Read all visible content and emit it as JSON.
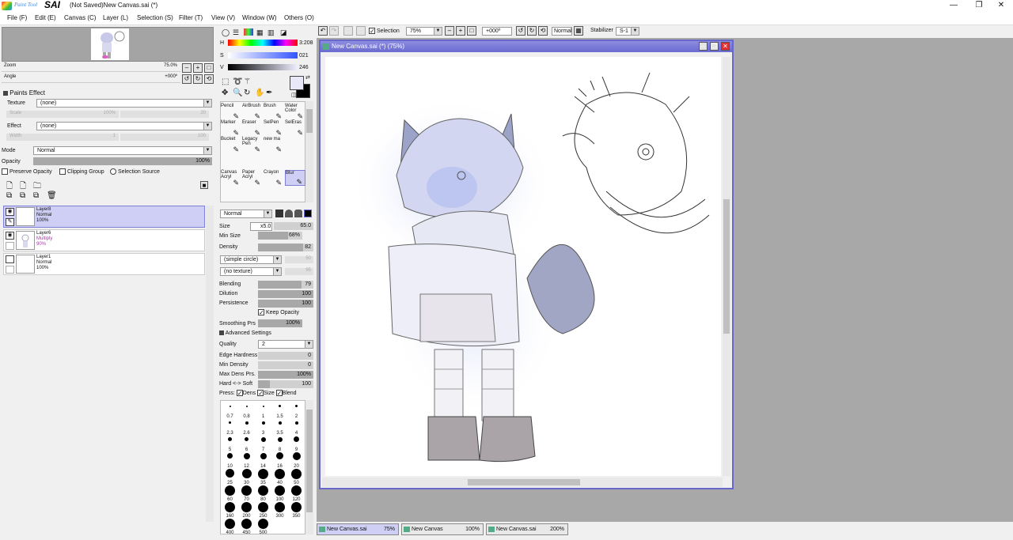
{
  "window": {
    "logo_small": "Paint Tool",
    "logo_big": "SAI",
    "title": "(Not Saved)New Canvas.sai (*)",
    "minimize": "—",
    "maximize": "❐",
    "close": "✕"
  },
  "menu": [
    "File (F)",
    "Edit (E)",
    "Canvas (C)",
    "Layer (L)",
    "Selection (S)",
    "Filter (T)",
    "View (V)",
    "Window (W)",
    "Others (O)"
  ],
  "navigator": {
    "zoom_label": "Zoom",
    "zoom_value": "75.0%",
    "angle_label": "Angle",
    "angle_value": "+000º"
  },
  "paints_effect": {
    "header": "Paints Effect",
    "texture_label": "Texture",
    "texture_value": "(none)",
    "scale_label": "Scale",
    "scale_value": "100%",
    "scale_num": "20",
    "effect_label": "Effect",
    "effect_value": "(none)",
    "width_label": "Width",
    "width_value": "1",
    "width_num": "100"
  },
  "layer_props": {
    "mode_label": "Mode",
    "mode_value": "Normal",
    "opacity_label": "Opacity",
    "opacity_value": "100%",
    "opacity_frac": 1.0,
    "preserve_opacity": "Preserve Opacity",
    "clipping_group": "Clipping Group",
    "selection_source": "Selection Source"
  },
  "layers": [
    {
      "name": "Layer8",
      "mode": "Normal",
      "opacity": "100%",
      "selected": true
    },
    {
      "name": "Layer6",
      "mode": "Multiply",
      "opacity": "90%",
      "selected": false
    },
    {
      "name": "Layer1",
      "mode": "Normal",
      "opacity": "100%",
      "selected": false
    }
  ],
  "color": {
    "h_label": "H",
    "h_value": "3:208",
    "s_label": "S",
    "s_value": "021",
    "v_label": "V",
    "v_value": "246",
    "fg": "#e8e8f8",
    "bg": "#000000"
  },
  "brushes": [
    {
      "name": "Pencil",
      "icon": "pencil-icon"
    },
    {
      "name": "AirBrush",
      "icon": "airbrush-icon"
    },
    {
      "name": "Brush",
      "icon": "brush-icon"
    },
    {
      "name": "Water Color",
      "icon": "watercolor-icon"
    },
    {
      "name": "Marker",
      "icon": "marker-icon"
    },
    {
      "name": "Eraser",
      "icon": "eraser-icon"
    },
    {
      "name": "SelPen",
      "icon": "selpen-icon"
    },
    {
      "name": "SelEras",
      "icon": "seleras-icon"
    },
    {
      "name": "Bucket",
      "icon": "bucket-icon"
    },
    {
      "name": "Legacy Pen",
      "icon": "legacy-pen-icon"
    },
    {
      "name": "new ma",
      "icon": "new-marker-icon"
    },
    {
      "name": "",
      "icon": ""
    },
    {
      "name": "",
      "icon": ""
    },
    {
      "name": "",
      "icon": ""
    },
    {
      "name": "",
      "icon": ""
    },
    {
      "name": "",
      "icon": ""
    },
    {
      "name": "Canvas Acryl",
      "icon": "canvas-acrylic-icon"
    },
    {
      "name": "Paper Acryl",
      "icon": "paper-acrylic-icon"
    },
    {
      "name": "Crayon",
      "icon": "crayon-icon"
    },
    {
      "name": "Blur",
      "icon": "blur-icon"
    }
  ],
  "brush_settings": {
    "blend_mode": "Normal",
    "size_label": "Size",
    "size_mult": "x5.0",
    "size_value": "65.0",
    "min_size_label": "Min Size",
    "min_size_value": "68%",
    "min_size_frac": 0.68,
    "density_label": "Density",
    "density_value": "82",
    "density_frac": 0.82,
    "shape_value": "(simple circle)",
    "shape_num": "50",
    "texture_value": "(no texture)",
    "texture_num": "95",
    "blending_label": "Blending",
    "blending_value": "79",
    "blending_frac": 0.79,
    "dilution_label": "Dilution",
    "dilution_value": "100",
    "dilution_frac": 1.0,
    "persistence_label": "Persistence",
    "persistence_value": "100",
    "persistence_frac": 1.0,
    "keep_opacity": "Keep Opacity",
    "smoothing_label": "Smoothing Prs",
    "smoothing_value": "100%",
    "smoothing_frac": 1.0,
    "advanced_header": "Advanced Settings",
    "quality_label": "Quality",
    "quality_value": "2",
    "edge_hardness_label": "Edge Hardness",
    "edge_hardness_value": "0",
    "edge_hardness_frac": 0.0,
    "min_density_label": "Min Density",
    "min_density_value": "0",
    "min_density_frac": 0.0,
    "max_dens_label": "Max Dens Prs.",
    "max_dens_value": "100%",
    "max_dens_frac": 1.0,
    "hard_soft_label": "Hard <-> Soft",
    "hard_soft_value": "100",
    "hard_soft_frac": 0.22,
    "press_label": "Press:",
    "press_dens": "Dens",
    "press_size": "Size",
    "press_blend": "Blend"
  },
  "brush_sizes": [
    "0.7",
    "0.8",
    "1",
    "1.5",
    "2",
    "2.3",
    "2.6",
    "3",
    "3.5",
    "4",
    "5",
    "6",
    "7",
    "8",
    "9",
    "10",
    "12",
    "14",
    "16",
    "20",
    "25",
    "30",
    "35",
    "40",
    "50",
    "60",
    "70",
    "80",
    "100",
    "120",
    "160",
    "200",
    "250",
    "300",
    "350",
    "400",
    "450",
    "500"
  ],
  "toolbar": {
    "selection_label": "Selection",
    "zoom_value": "75%",
    "angle_value": "+000º",
    "blend_value": "Normal",
    "stabilizer_label": "Stabilizer",
    "stabilizer_value": "S-1"
  },
  "canvas_window": {
    "title": "New Canvas.sai (*) (75%)"
  },
  "doc_tabs": [
    {
      "name": "New Canvas.sai",
      "zoom": "75%",
      "active": true
    },
    {
      "name": "New Canvas",
      "zoom": "100%",
      "active": false
    },
    {
      "name": "New Canvas.sai",
      "zoom": "200%",
      "active": false
    }
  ]
}
